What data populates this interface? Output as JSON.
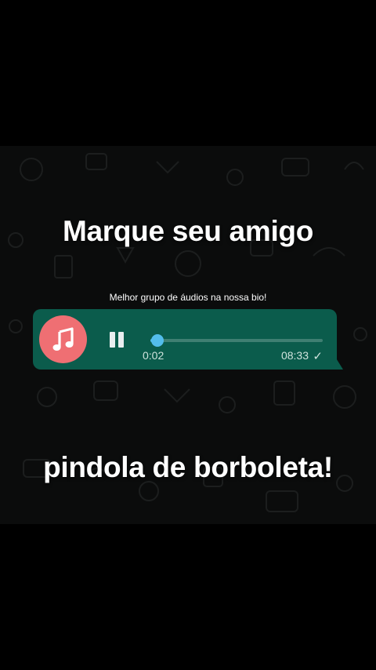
{
  "headline_top": "Marque seu amigo",
  "caption": "Melhor grupo de áudios na nossa bio!",
  "headline_bottom": "pindola de borboleta!",
  "audio_message": {
    "avatar_icon": "music-note-icon",
    "control_icon": "pause-icon",
    "elapsed": "0:02",
    "timestamp": "08:33",
    "status_icon": "check-icon",
    "progress": 0.04
  },
  "colors": {
    "bubble": "#0b5c4c",
    "avatar": "#ef6f73",
    "progress": "#53bdeb",
    "background": "#000000"
  }
}
